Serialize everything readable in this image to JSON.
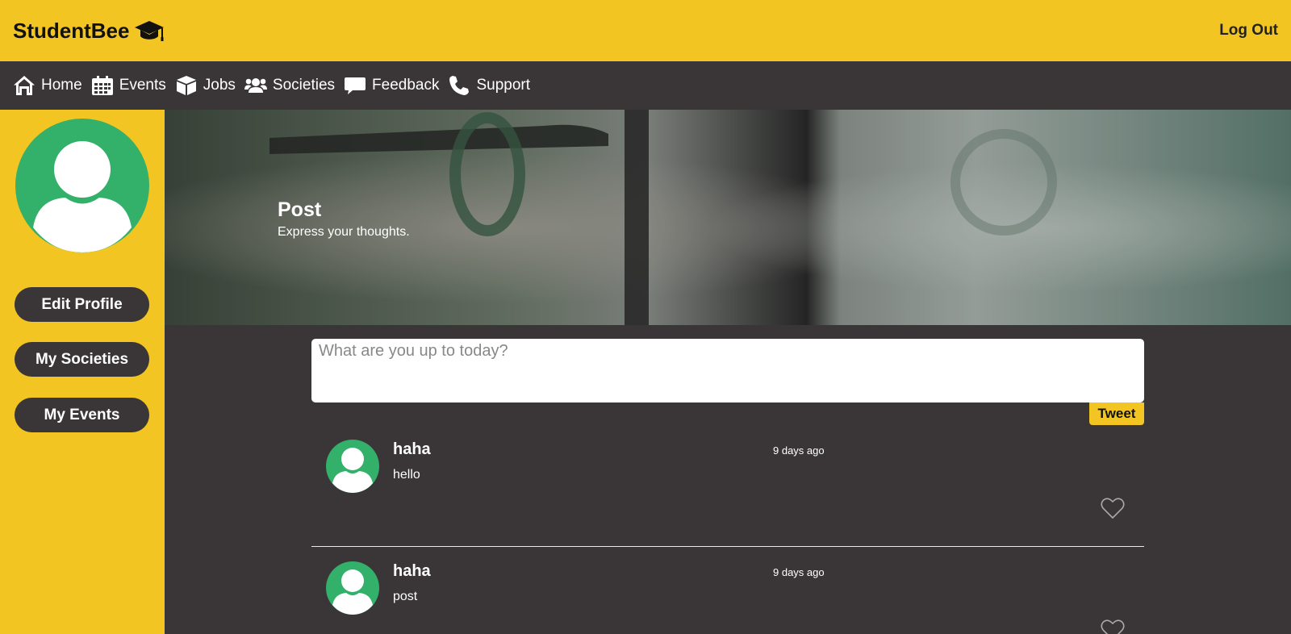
{
  "brand": {
    "name": "StudentBee",
    "icon": "graduation-cap-icon"
  },
  "header": {
    "logout_label": "Log Out"
  },
  "nav": {
    "items": [
      {
        "label": "Home",
        "icon": "home-icon"
      },
      {
        "label": "Events",
        "icon": "calendar-icon"
      },
      {
        "label": "Jobs",
        "icon": "box-icon"
      },
      {
        "label": "Societies",
        "icon": "users-icon"
      },
      {
        "label": "Feedback",
        "icon": "comment-icon"
      },
      {
        "label": "Support",
        "icon": "phone-icon"
      }
    ]
  },
  "sidebar": {
    "buttons": [
      {
        "label": "Edit Profile"
      },
      {
        "label": "My Societies"
      },
      {
        "label": "My Events"
      }
    ]
  },
  "banner": {
    "title": "Post",
    "subtitle": "Express your thoughts."
  },
  "compose": {
    "placeholder": "What are you up to today?",
    "tweet_label": "Tweet"
  },
  "posts": [
    {
      "user": "haha",
      "time": "9 days ago",
      "body": "hello"
    },
    {
      "user": "haha",
      "time": "9 days ago",
      "body": "post"
    }
  ],
  "colors": {
    "accent": "#f2c522",
    "dark": "#3a3638",
    "avatar": "#33b06a"
  }
}
